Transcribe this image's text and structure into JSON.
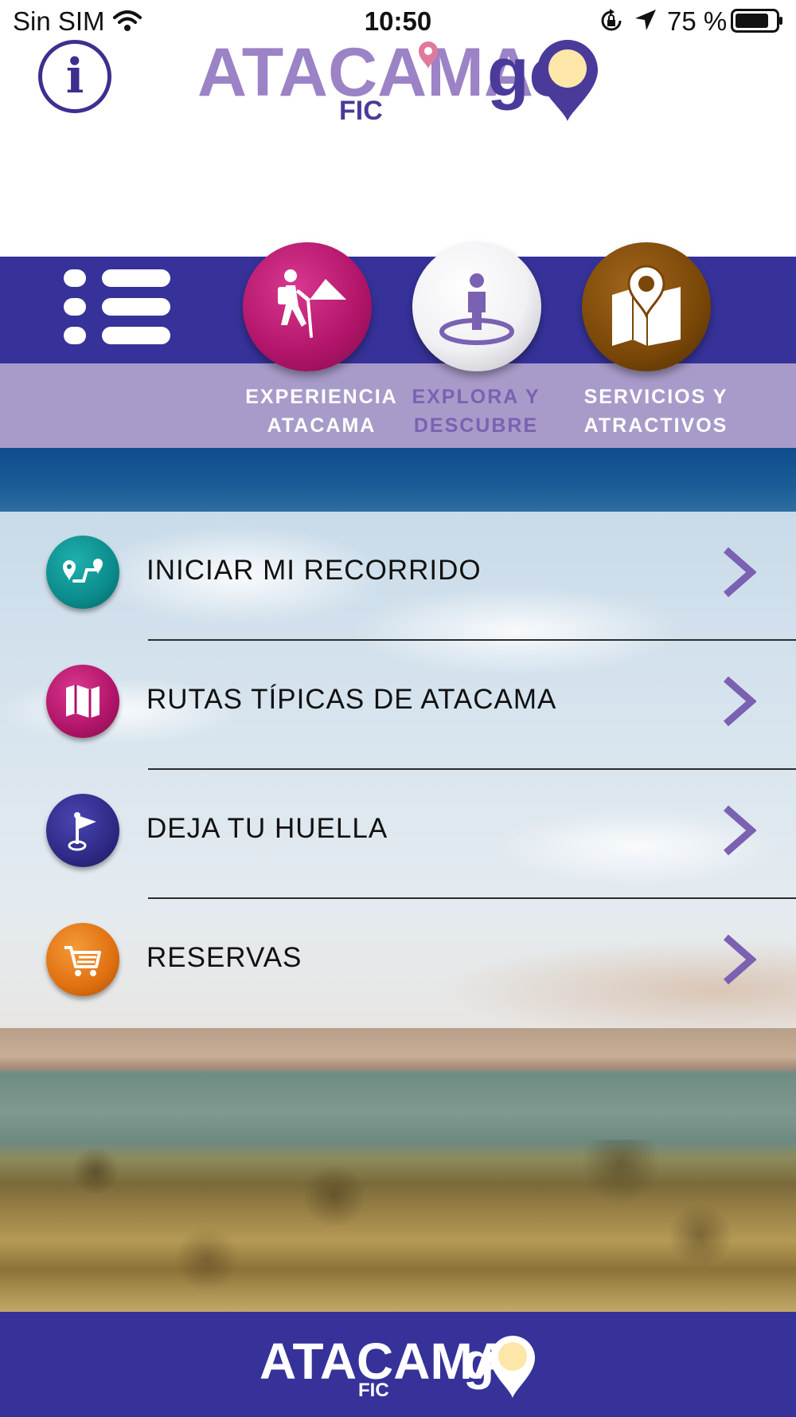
{
  "status_bar": {
    "carrier": "Sin SIM",
    "time": "10:50",
    "battery_percent": "75 %"
  },
  "logo": {
    "word_atacama": "ATACAMA",
    "word_go": "go",
    "word_fic": "FIC"
  },
  "nav": {
    "tabs": [
      {
        "line1": "EXPERIENCIA",
        "line2": "ATACAMA",
        "icon": "hiker-icon",
        "color": "#b01468"
      },
      {
        "line1": "EXPLORA Y",
        "line2": "DESCUBRE",
        "icon": "person-location-icon",
        "color": "#f1f0f3",
        "selected": true
      },
      {
        "line1": "SERVICIOS Y",
        "line2": "ATRACTIVOS",
        "icon": "map-pin-icon",
        "color": "#7a4707"
      }
    ]
  },
  "menu": {
    "items": [
      {
        "label": "INICIAR MI RECORRIDO",
        "icon": "route-icon",
        "color": "#0b8b8b"
      },
      {
        "label": "RUTAS TÍPICAS DE ATACAMA",
        "icon": "map-icon",
        "color": "#b01468"
      },
      {
        "label": "DEJA TU HUELLA",
        "icon": "flag-icon",
        "color": "#2e2a86"
      },
      {
        "label": "RESERVAS",
        "icon": "cart-icon",
        "color": "#e07010"
      }
    ]
  },
  "colors": {
    "brand_purple": "#36329a",
    "label_band": "#a89bc9",
    "accent_violet": "#7a61b2",
    "logo_lilac": "#9b83c6"
  }
}
